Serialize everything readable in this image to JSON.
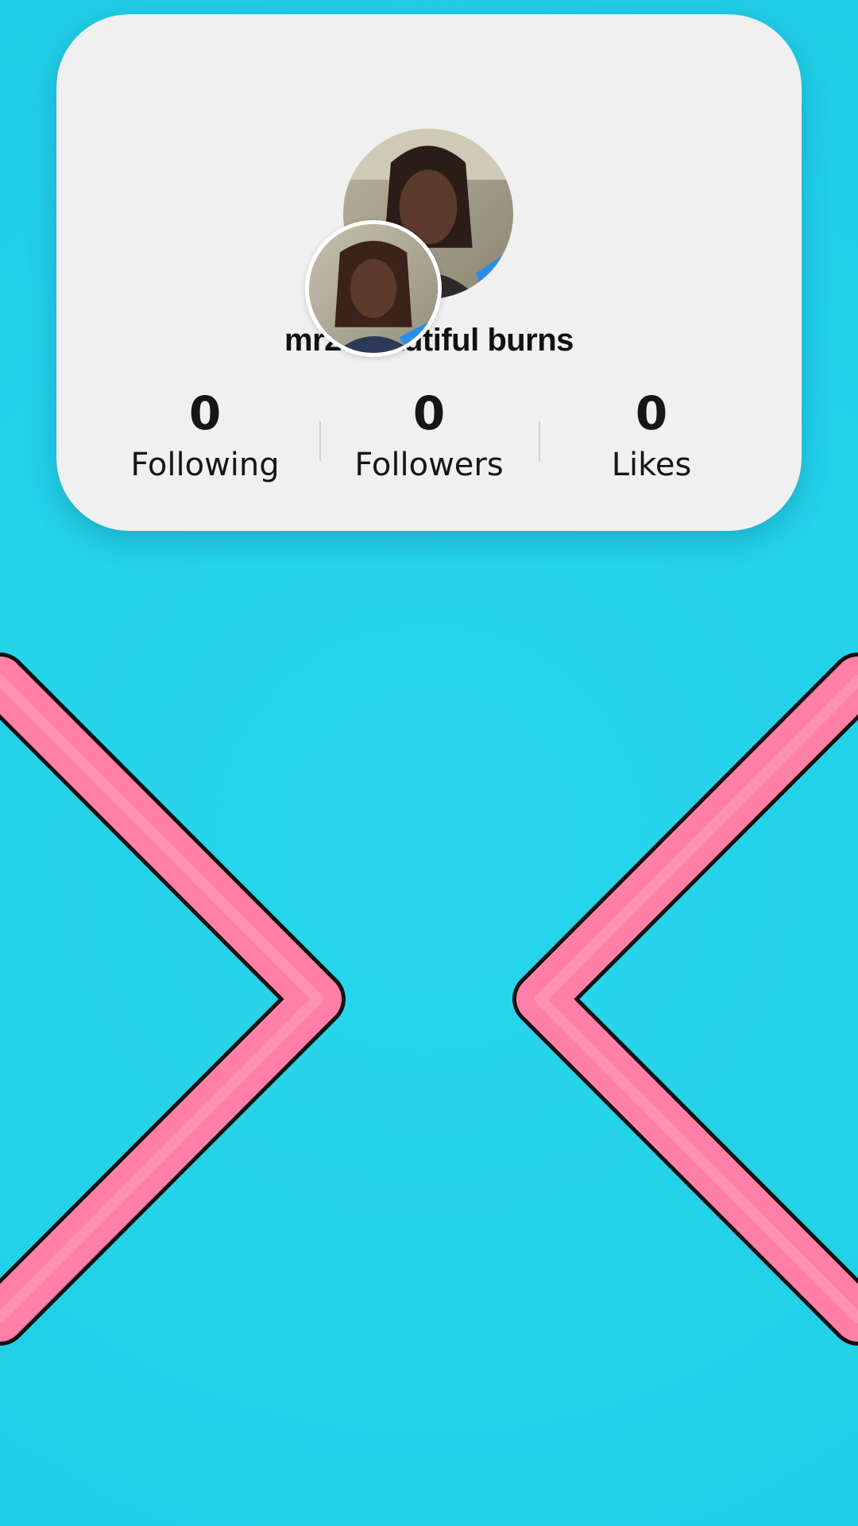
{
  "profile": {
    "username": "mr2 beautiful burns",
    "avatar_main": "profile-photo",
    "avatar_small": "profile-photo",
    "stats": {
      "following_value": "0",
      "following_label": "Following",
      "followers_value": "0",
      "followers_label": "Followers",
      "likes_value": "0",
      "likes_label": "Likes"
    }
  },
  "controls": {
    "left_arrow_icon": "chevron-right-icon",
    "right_arrow_icon": "chevron-left-icon"
  },
  "colors": {
    "background": "#25d2ea",
    "card": "#f0f0f0",
    "chevron": "#ff7fa6",
    "chevron_outline": "#111111"
  }
}
